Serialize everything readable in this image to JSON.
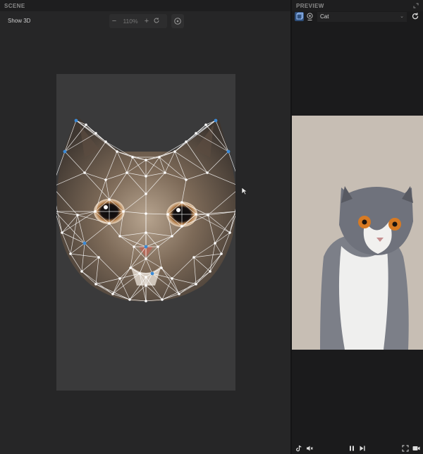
{
  "scene": {
    "header": "SCENE",
    "show3d": "Show 3D",
    "zoom": {
      "value": "110%",
      "minus": "−",
      "plus": "+"
    }
  },
  "preview": {
    "header": "PREVIEW",
    "select_value": "Cat",
    "subject": "Cat"
  },
  "colors": {
    "accent": "#3b8ad6",
    "canvas_bg": "#3a3a3b",
    "panel_bg": "#262627",
    "photo_bg": "#c7beb4"
  }
}
